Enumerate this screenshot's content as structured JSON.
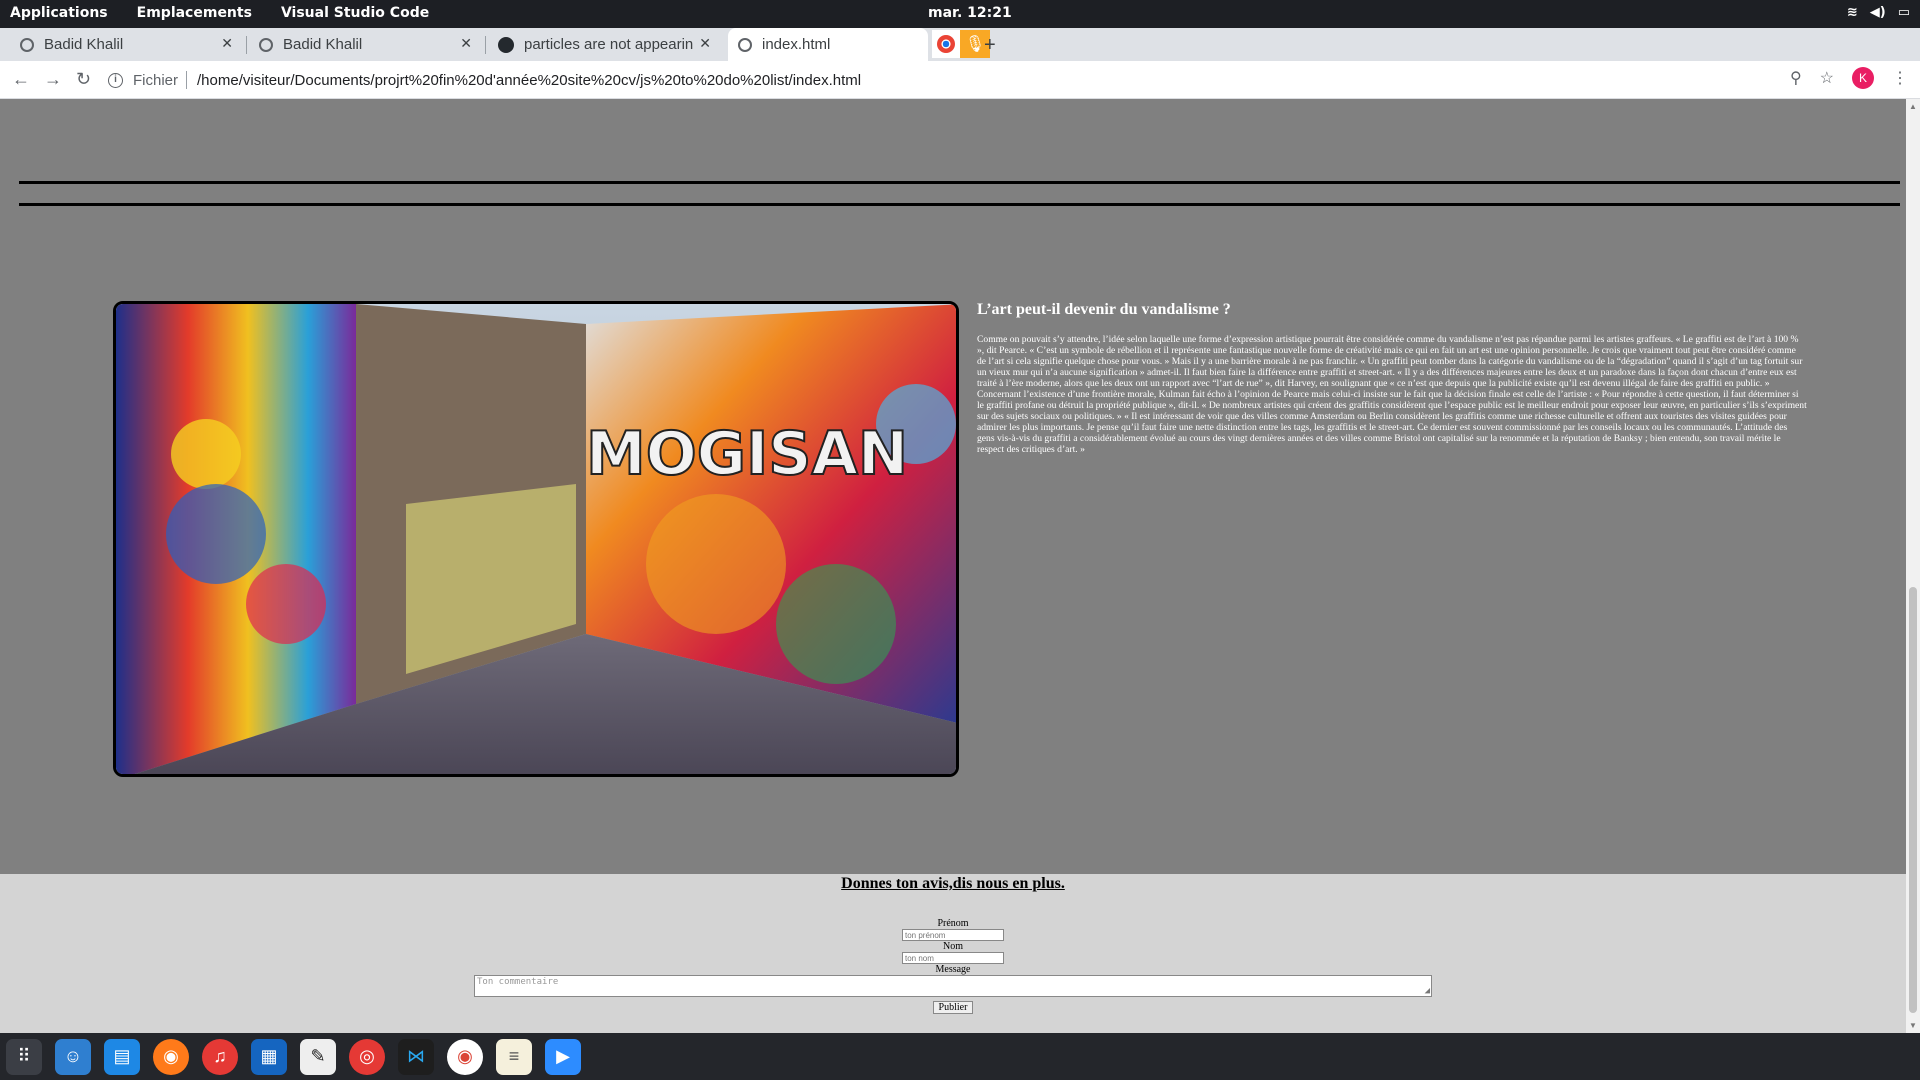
{
  "topbar": {
    "menus": [
      "Applications",
      "Emplacements",
      "Visual Studio Code"
    ],
    "clock": "mar. 12:21"
  },
  "tabs": [
    {
      "title": "Badid Khalil"
    },
    {
      "title": "Badid Khalil"
    },
    {
      "title": "particles are not appearin"
    },
    {
      "title": "index.html"
    }
  ],
  "omnibox": {
    "scheme": "Fichier",
    "url": "/home/visiteur/Documents/projrt%20fin%20d'année%20site%20cv/js%20to%20do%20list/index.html"
  },
  "profile": {
    "initial": "K"
  },
  "article": {
    "title": "L’art peut-il devenir du vandalisme ?",
    "body": "Comme on pouvait s’y attendre, l’idée selon laquelle une forme d’expression artistique pourrait être considérée comme du vandalisme n’est pas répandue parmi les artistes graffeurs. « Le graffiti est de l’art à 100 % », dit Pearce. « C’est un symbole de rébellion et il représente une fantastique nouvelle forme de créativité mais ce qui en fait un art est une opinion personnelle. Je crois que vraiment tout peut être considéré comme de l’art si cela signifie quelque chose pour vous. » Mais il y a une barrière morale à ne pas franchir. « Un graffiti peut tomber dans la catégorie du vandalisme ou de la “dégradation” quand il s’agit d’un tag fortuit sur un vieux mur qui n’a aucune signification » admet-il. Il faut bien faire la différence entre graffiti et street-art. « Il y a des différences majeures entre les deux et un paradoxe dans la façon dont chacun d’entre eux est traité à l’ère moderne, alors que les deux ont un rapport avec “l’art de rue” », dit Harvey, en soulignant que « ce n’est que depuis que la publicité existe qu’il est devenu illégal de faire des graffiti en public. » Concernant l’existence d’une frontière morale, Kulman fait écho à l’opinion de Pearce mais celui-ci insiste sur le fait que la décision finale est celle de l’artiste : « Pour répondre à cette question, il faut déterminer si le graffiti profane ou détruit la propriété publique », dit-il. « De nombreux artistes qui créent des graffitis considèrent que l’espace public est le meilleur endroit pour exposer leur œuvre, en particulier s’ils s’expriment sur des sujets sociaux ou politiques. » « Il est intéressant de voir que des villes comme Amsterdam ou Berlin considèrent les graffitis comme une richesse culturelle et offrent aux touristes des visites guidées pour admirer les plus importants. Je pense qu’il faut faire une nette distinction entre les tags, les graffitis et le street-art. Ce dernier est souvent commissionné par les conseils locaux ou les communautés. L’attitude des gens vis-à-vis du graffiti a considérablement évolué au cours des vingt dernières années et des villes comme Bristol ont capitalisé sur la renommée et la réputation de Banksy ; bien entendu, son travail mérite le respect des critiques d’art. »"
  },
  "feedback": {
    "heading": "Donnes ton avis,dis nous en plus.",
    "prenom_label": "Prénom",
    "prenom_placeholder": "ton prénom",
    "nom_label": "Nom",
    "nom_placeholder": "ton nom",
    "message_label": "Message",
    "message_placeholder": "Ton commentaire",
    "submit": "Publier"
  },
  "dock": [
    "apps-grid-icon",
    "finder-icon",
    "notes-icon",
    "firefox-icon",
    "music-icon",
    "writer-icon",
    "inkscape-icon",
    "help-icon",
    "vscode-icon",
    "chrome-icon",
    "text-editor-icon",
    "zoom-icon"
  ]
}
